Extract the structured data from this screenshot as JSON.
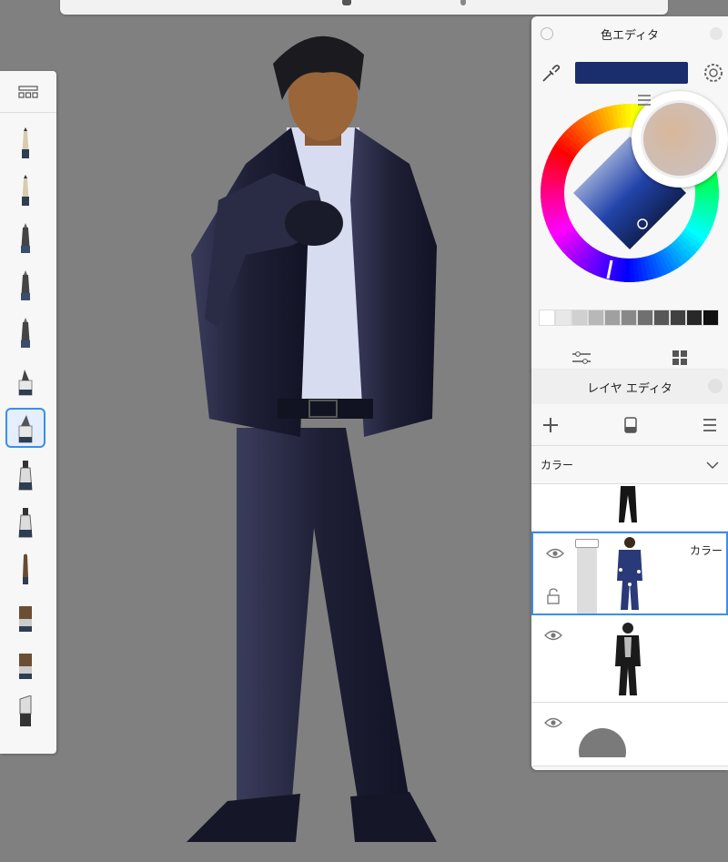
{
  "color_editor": {
    "title": "色エディタ",
    "current_color": "#1a2d6d",
    "grayscale_swatches": [
      "#ffffff",
      "#e8e8e8",
      "#d0d0d0",
      "#b8b8b8",
      "#a0a0a0",
      "#888888",
      "#707070",
      "#585858",
      "#404040",
      "#282828",
      "#101010"
    ]
  },
  "layer_editor": {
    "title": "レイヤ エディタ",
    "blend_mode": "カラー",
    "layers": [
      {
        "label": "",
        "selected": false
      },
      {
        "label": "カラー",
        "selected": true
      },
      {
        "label": "",
        "selected": false
      },
      {
        "label": "",
        "selected": false
      }
    ]
  },
  "colors": {
    "canvas_bg": "#808080",
    "selection_accent": "#3b8fe8",
    "suit": "#1e1f35"
  }
}
